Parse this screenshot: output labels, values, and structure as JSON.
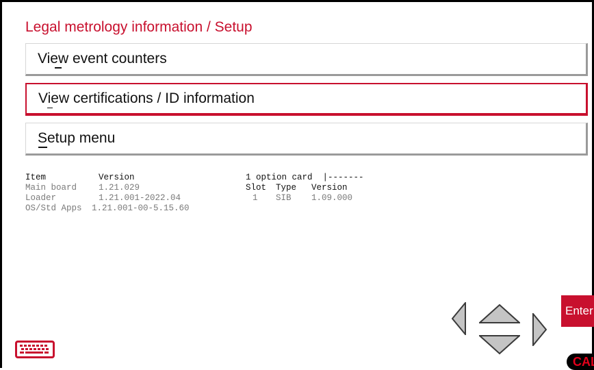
{
  "header": {
    "title": "Legal metrology information / Setup"
  },
  "menu": [
    {
      "label": "View event counters",
      "selected": false
    },
    {
      "label": "View certifications / ID information",
      "selected": true
    },
    {
      "label": "Setup menu",
      "selected": false
    }
  ],
  "versions": {
    "col_item": "Item",
    "col_version": "Version",
    "rows": [
      {
        "item": "Main board",
        "version": "1.21.029"
      },
      {
        "item": "Loader",
        "version": "1.21.001-2022.04"
      },
      {
        "item": "OS/Std Apps",
        "version": "1.21.001-00-5.15.60"
      }
    ]
  },
  "option_cards": {
    "summary": "1 option card  |-------",
    "col_slot": "Slot",
    "col_type": "Type",
    "col_version": "Version",
    "rows": [
      {
        "slot": "1",
        "type": "SIB",
        "version": "1.09.000"
      }
    ]
  },
  "controls": {
    "enter_label": "Enter",
    "cal_label": "CAL",
    "keyboard_icon": "keyboard-icon",
    "nav_icons": [
      "arrow-left-icon",
      "arrow-up-icon",
      "arrow-down-icon",
      "arrow-right-icon"
    ]
  },
  "colors": {
    "accent": "#c8102e",
    "text": "#111111",
    "dim_text": "#7a7a7a"
  }
}
